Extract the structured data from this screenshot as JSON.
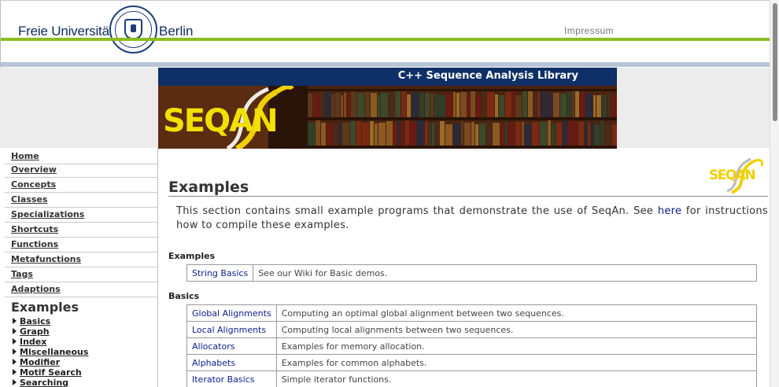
{
  "header": {
    "org_left": "Freie Universität",
    "org_right": "Berlin",
    "impressum": "Impressum"
  },
  "banner": {
    "title": "C++ Sequence Analysis Library",
    "logo_text": "SEQAN"
  },
  "sidebar": {
    "items": [
      "Home",
      "Overview",
      "Concepts",
      "Classes",
      "Specializations",
      "Shortcuts",
      "Functions",
      "Metafunctions",
      "Tags",
      "Adaptions"
    ],
    "section_heading": "Examples",
    "sub_items": [
      "Basics",
      "Graph",
      "Index",
      "Miscellaneous",
      "Modifier",
      "Motif Search",
      "Searching"
    ]
  },
  "main": {
    "title": "Examples",
    "logo_text": "SEQAN",
    "intro_before": "This section contains small example programs that demonstrate the use of SeqAn. See ",
    "intro_link": "here",
    "intro_after": " for instructions how to compile these examples.",
    "sections": [
      {
        "heading": "Examples",
        "rows": [
          {
            "name": "String Basics",
            "desc": "See our Wiki for Basic demos."
          }
        ]
      },
      {
        "heading": "Basics",
        "rows": [
          {
            "name": "Global Alignments",
            "desc": "Computing an optimal global alignment between two sequences."
          },
          {
            "name": "Local Alignments",
            "desc": "Computing local alignments between two sequences."
          },
          {
            "name": "Allocators",
            "desc": "Examples for memory allocation."
          },
          {
            "name": "Alphabets",
            "desc": "Examples for common alphabets."
          },
          {
            "name": "Iterator Basics",
            "desc": "Simple iterator functions."
          }
        ]
      }
    ]
  },
  "colors": {
    "fu_blue": "#0b2a5c",
    "fu_green": "#8cbd1f",
    "banner_blue": "#0e3066",
    "link": "#0b1e8c",
    "seqan_yellow": "#f2e000"
  }
}
